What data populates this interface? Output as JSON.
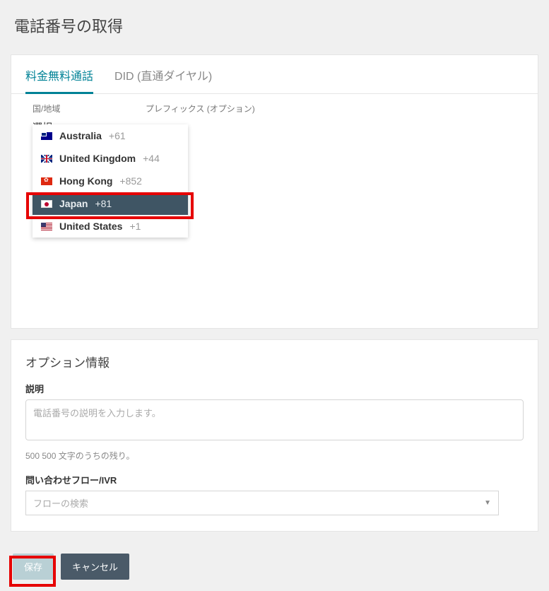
{
  "page": {
    "title": "電話番号の取得"
  },
  "tabs": {
    "toll_free": "料金無料通話",
    "did": "DID (直通ダイヤル)"
  },
  "filters": {
    "country_label": "国/地域",
    "country_value": "選択",
    "prefix_label": "プレフィックス (オプション)"
  },
  "countries": [
    {
      "name": "Australia",
      "code": "+61",
      "flag": "au",
      "selected": false
    },
    {
      "name": "United Kingdom",
      "code": "+44",
      "flag": "uk",
      "selected": false
    },
    {
      "name": "Hong Kong",
      "code": "+852",
      "flag": "hk",
      "selected": false
    },
    {
      "name": "Japan",
      "code": "+81",
      "flag": "jp",
      "selected": true
    },
    {
      "name": "United States",
      "code": "+1",
      "flag": "us",
      "selected": false
    }
  ],
  "options": {
    "section_title": "オプション情報",
    "description_label": "説明",
    "description_placeholder": "電話番号の説明を入力します。",
    "char_count": "500 500 文字のうちの残り。",
    "flow_label": "問い合わせフロー/IVR",
    "flow_placeholder": "フローの検索"
  },
  "buttons": {
    "save": "保存",
    "cancel": "キャンセル"
  }
}
